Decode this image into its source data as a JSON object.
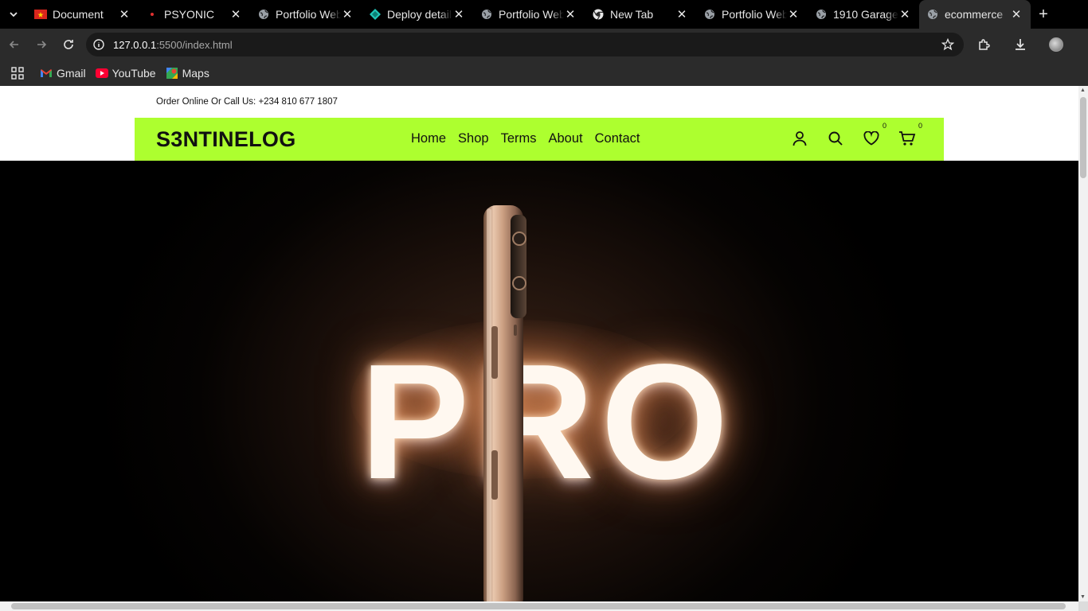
{
  "browser": {
    "tabs": [
      {
        "title": "Document",
        "icon": "flag-favicon"
      },
      {
        "title": "PSYONIC",
        "icon": "red-dot-favicon"
      },
      {
        "title": "Portfolio Website",
        "icon": "globe-favicon"
      },
      {
        "title": "Deploy details",
        "icon": "netlify-favicon"
      },
      {
        "title": "Portfolio Website",
        "icon": "globe-favicon"
      },
      {
        "title": "New Tab",
        "icon": "chrome-favicon"
      },
      {
        "title": "Portfolio Website",
        "icon": "globe-favicon"
      },
      {
        "title": "1910 Garage",
        "icon": "globe-favicon"
      },
      {
        "title": "ecommerce",
        "icon": "globe-favicon"
      }
    ],
    "url_host": "127.0.0.1",
    "url_path": ":5500/index.html",
    "bookmarks": [
      {
        "label": "Gmail",
        "icon": "gmail-icon"
      },
      {
        "label": "YouTube",
        "icon": "youtube-icon"
      },
      {
        "label": "Maps",
        "icon": "maps-icon"
      }
    ]
  },
  "page": {
    "topbar_text": "Order Online Or Call Us: +234 810 677 1807",
    "brand": "S3NTINELOG",
    "nav": [
      "Home",
      "Shop",
      "Terms",
      "About",
      "Contact"
    ],
    "wishlist_count": "0",
    "cart_count": "0",
    "accent": "#adff2f",
    "hero_word": "PRO"
  }
}
